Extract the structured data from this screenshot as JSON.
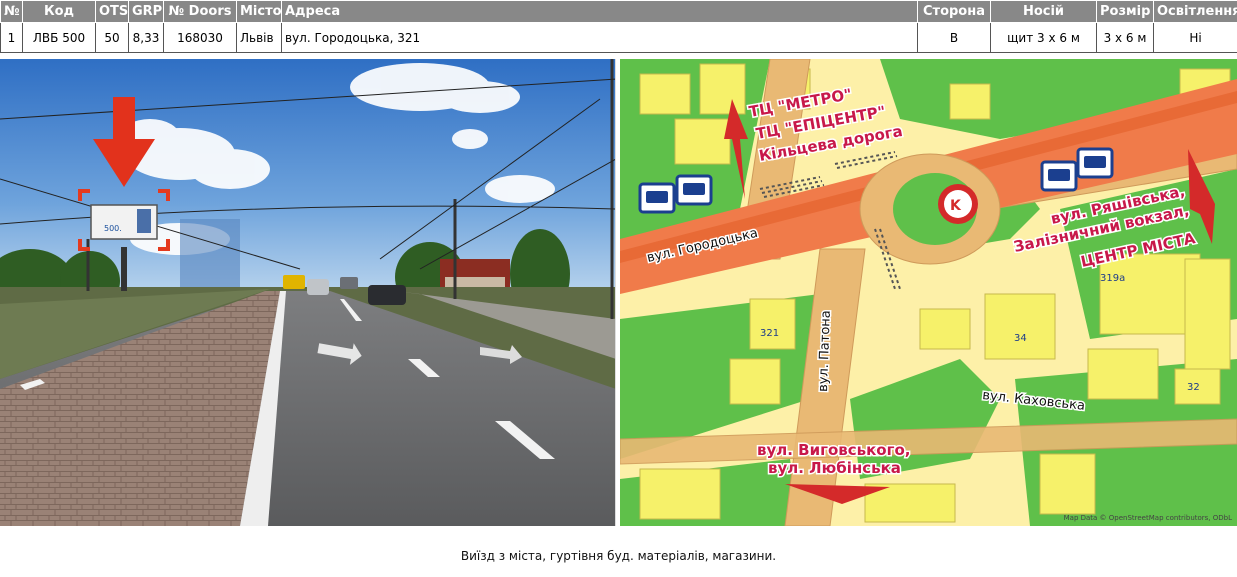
{
  "columns": {
    "num": "№",
    "code": "Код",
    "ots": "OTS",
    "grp": "GRP",
    "doors": "№ Doors",
    "city": "Місто",
    "address": "Адреса",
    "side": "Сторона",
    "carrier": "Носій",
    "size": "Розмір",
    "lighting": "Освітлення"
  },
  "row": {
    "num": "1",
    "code": "ЛВБ 500",
    "ots": "50",
    "grp": "8,33",
    "doors": "168030",
    "city": "Львів",
    "address": "вул. Городоцька, 321",
    "side": "В",
    "carrier": "щит 3 x 6 м",
    "size": "3 x 6 м",
    "lighting": "Ні"
  },
  "photo": {
    "billboard_text": "500."
  },
  "map": {
    "callout_north": [
      "ТЦ \"МЕТРО\"",
      "ТЦ \"ЕПІЦЕНТР\"",
      "Кільцева дорога"
    ],
    "callout_east": [
      "вул. Ряшівська,",
      "Залізничний вокзал,",
      "ЦЕНТР МІСТА"
    ],
    "callout_south": [
      "вул. Виговського,",
      "вул. Любінська"
    ],
    "street_gorodotska": "вул. Городоцька",
    "street_patona": "вул. Патона",
    "street_kakhovska": "вул. Каховська",
    "building_321a": "321",
    "building_34": "34",
    "building_319a": "319а",
    "building_32": "32",
    "attribution": "Map Data © OpenStreetMap contributors, ODbL",
    "colors": {
      "route_arrow": "#d42a2a",
      "callout_text": "#c8184a",
      "main_road": "#f07b4a",
      "building": "#f6f16a",
      "green": "#5fc04a",
      "land": "#fdf0a8"
    }
  },
  "caption": "Виїзд з міста, гуртівня буд. матеріалів, магазини."
}
